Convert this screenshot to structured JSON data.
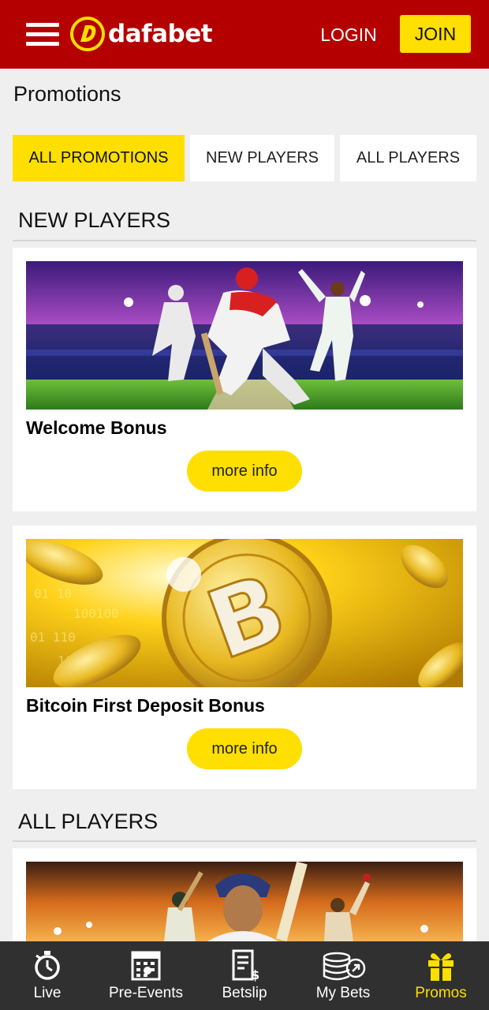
{
  "header": {
    "brand": "dafabet",
    "login_label": "LOGIN",
    "join_label": "JOIN",
    "brand_color": "#b50000",
    "accent_color": "#ffdf00"
  },
  "page": {
    "title": "Promotions"
  },
  "tabs": [
    {
      "label": "ALL PROMOTIONS",
      "active": true
    },
    {
      "label": "NEW PLAYERS",
      "active": false
    },
    {
      "label": "ALL PLAYERS",
      "active": false
    }
  ],
  "sections": [
    {
      "title": "NEW PLAYERS",
      "cards": [
        {
          "title": "Welcome Bonus",
          "button_label": "more info",
          "banner": "cricket-stadium-image"
        },
        {
          "title": "Bitcoin First Deposit Bonus",
          "button_label": "more info",
          "banner": "bitcoin-gold-coin-image"
        }
      ]
    },
    {
      "title": "ALL PLAYERS",
      "cards": [
        {
          "banner": "cricket-players-sunset-image"
        }
      ]
    }
  ],
  "bottom_nav": [
    {
      "label": "Live",
      "icon": "stopwatch-icon",
      "active": false
    },
    {
      "label": "Pre-Events",
      "icon": "calendar-icon",
      "active": false
    },
    {
      "label": "Betslip",
      "icon": "betslip-icon",
      "active": false
    },
    {
      "label": "My Bets",
      "icon": "coins-icon",
      "active": false
    },
    {
      "label": "Promos",
      "icon": "gift-icon",
      "active": true
    }
  ]
}
